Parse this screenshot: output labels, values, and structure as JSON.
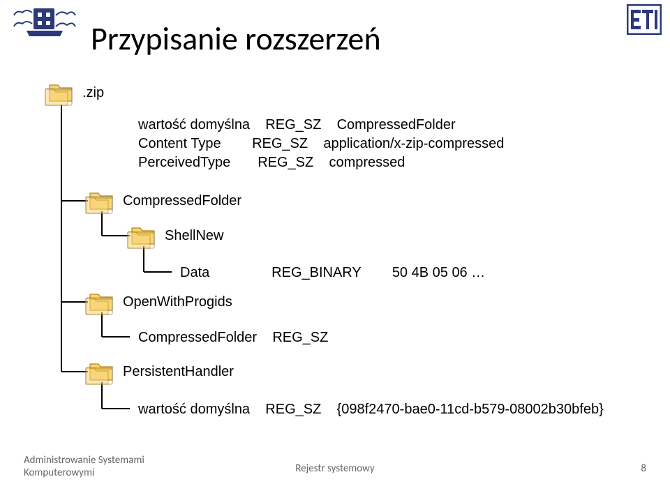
{
  "title": "Przypisanie rozszerzeń",
  "tree": {
    "root": ".zip",
    "root_values": [
      {
        "name": "wartość domyślna",
        "type": "REG_SZ",
        "data": "CompressedFolder"
      },
      {
        "name": "Content Type",
        "type": "REG_SZ",
        "data": "application/x-zip-compressed"
      },
      {
        "name": "PerceivedType",
        "type": "REG_SZ",
        "data": "compressed"
      }
    ],
    "child1": "CompressedFolder",
    "child1_child": "ShellNew",
    "shellnew_value": {
      "name": "Data",
      "type": "REG_BINARY",
      "data": "50 4B 05 06 …"
    },
    "openwith": "OpenWithProgids",
    "openwith_value": {
      "name": "CompressedFolder",
      "type": "REG_SZ",
      "data": ""
    },
    "persistent": "PersistentHandler",
    "persistent_value": {
      "name": "wartość domyślna",
      "type": "REG_SZ",
      "data": "{098f2470-bae0-11cd-b579-08002b30bfeb}"
    }
  },
  "footer": {
    "left1": "Administrowanie Systemami",
    "left2": "Komputerowymi",
    "center": "Rejestr systemowy",
    "right": "8"
  }
}
